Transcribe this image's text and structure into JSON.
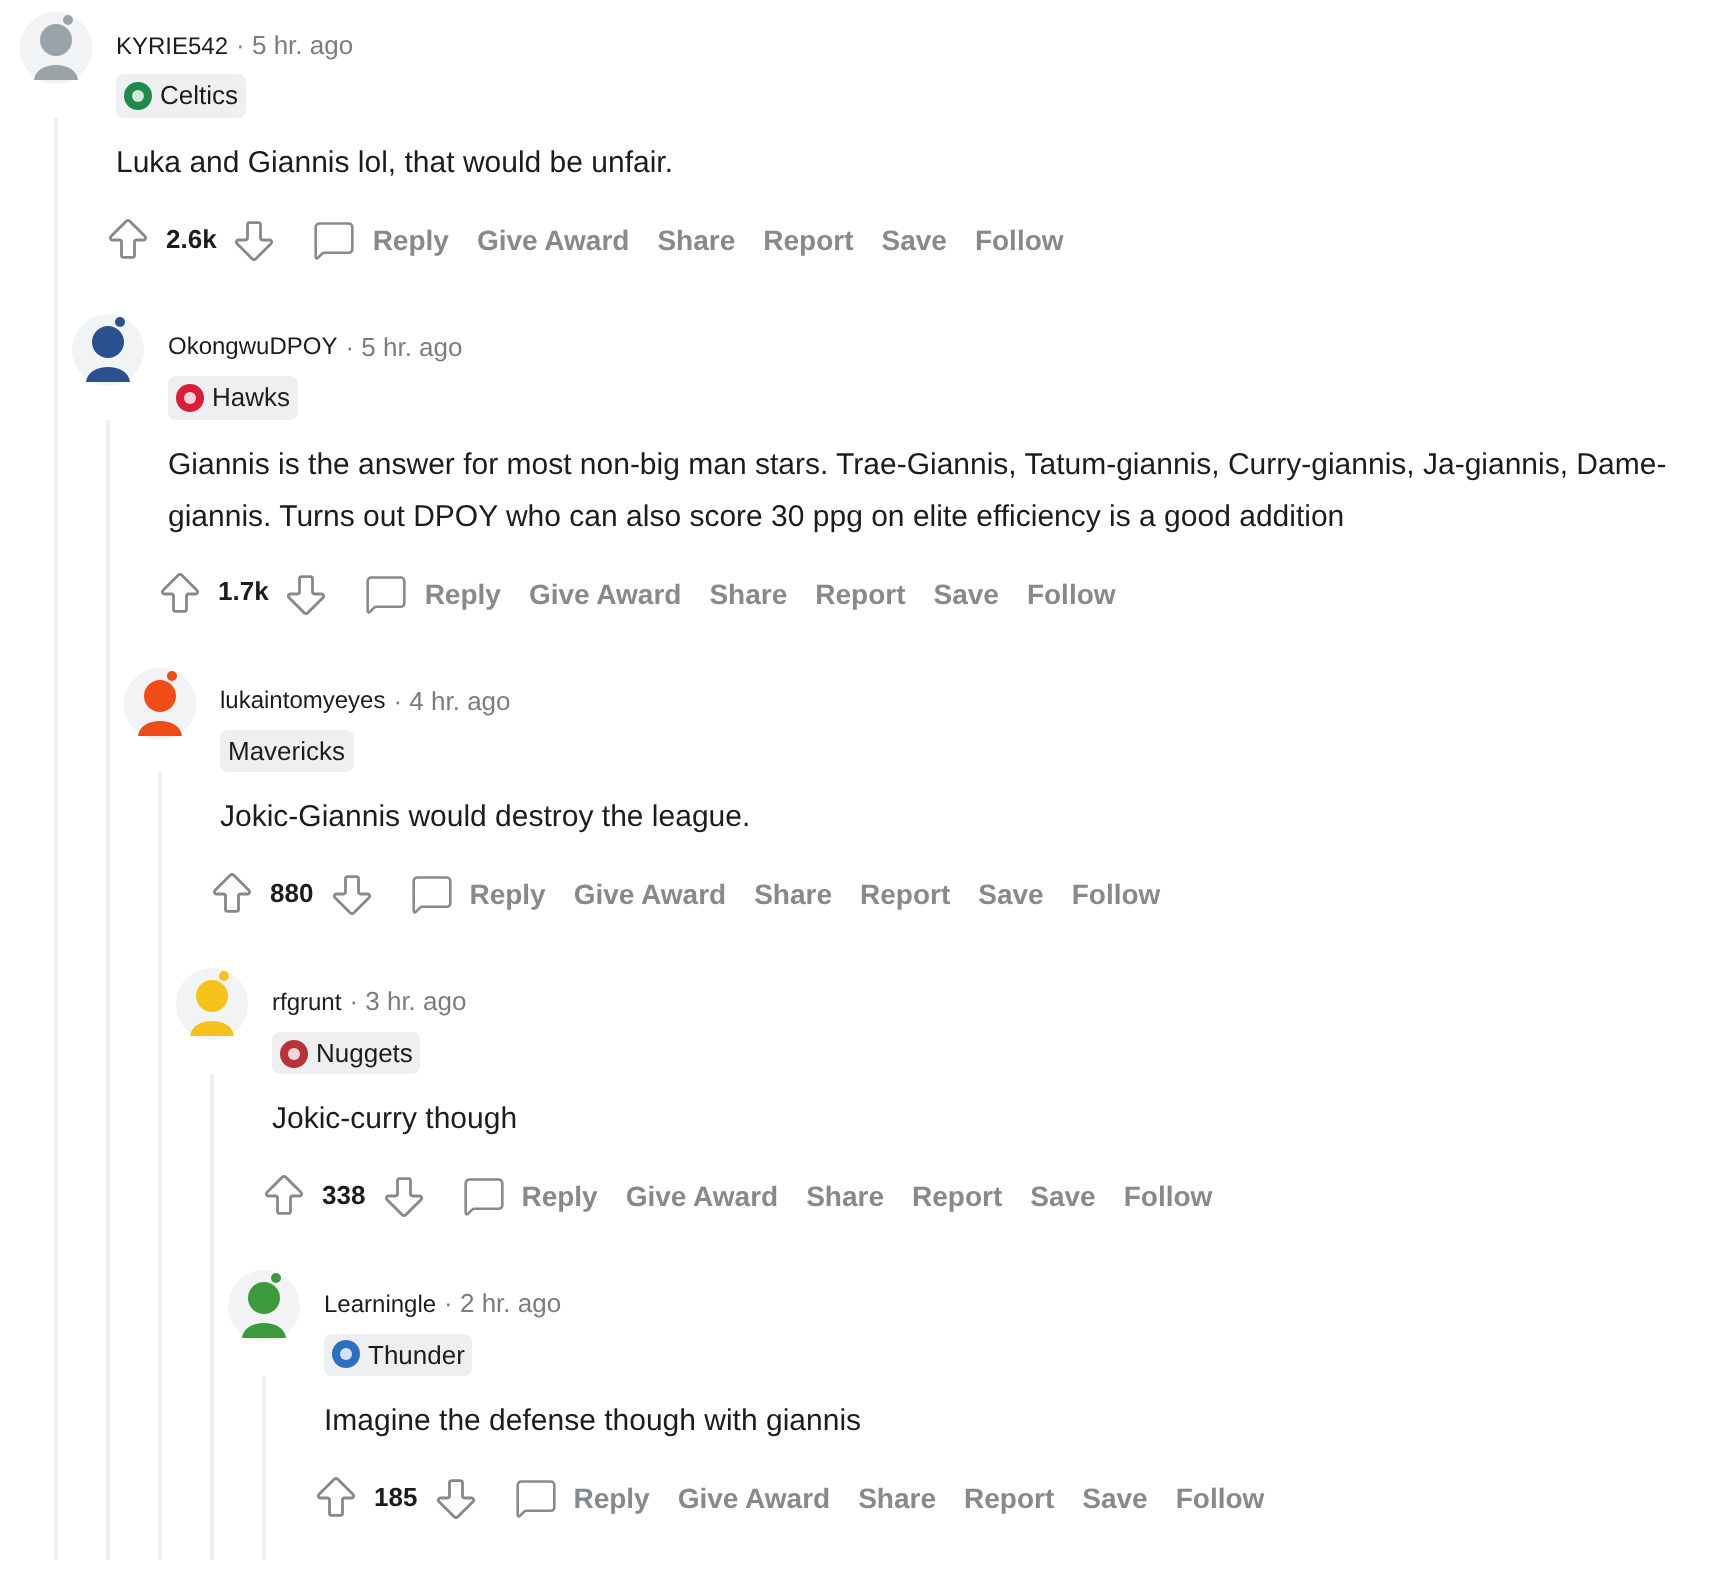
{
  "comments": [
    {
      "username": "KYRIE542",
      "time": "· 5 hr. ago",
      "avatar": {
        "color": "#9aa3a8"
      },
      "flair": {
        "label": "Celtics",
        "color": "#1f8a4c"
      },
      "body": "Luka and Giannis lol, that would be unfair.",
      "votes": "2.6k",
      "actions": [
        "Reply",
        "Give Award",
        "Share",
        "Report",
        "Save",
        "Follow"
      ],
      "children": [
        {
          "username": "OkongwuDPOY",
          "time": "· 5 hr. ago",
          "avatar": {
            "color": "#2b4f8f"
          },
          "flair": {
            "label": "Hawks",
            "color": "#d71f3a"
          },
          "body": "Giannis is the answer for most non-big man stars. Trae-Giannis, Tatum-giannis, Curry-giannis, Ja-giannis, Dame-giannis. Turns out DPOY who can also score 30 ppg on elite efficiency is a good addition",
          "votes": "1.7k",
          "actions": [
            "Reply",
            "Give Award",
            "Share",
            "Report",
            "Save",
            "Follow"
          ],
          "children": [
            {
              "username": "lukaintomyeyes",
              "time": "· 4 hr. ago",
              "avatar": {
                "color": "#ee4b16"
              },
              "flair": {
                "label": "Mavericks"
              },
              "body": "Jokic-Giannis would destroy the league.",
              "votes": "880",
              "actions": [
                "Reply",
                "Give Award",
                "Share",
                "Report",
                "Save",
                "Follow"
              ],
              "children": [
                {
                  "username": "rfgrunt",
                  "time": "· 3 hr. ago",
                  "avatar": {
                    "color": "#f4c21b"
                  },
                  "flair": {
                    "label": "Nuggets",
                    "color": "#b8323a"
                  },
                  "body": "Jokic-curry though",
                  "votes": "338",
                  "actions": [
                    "Reply",
                    "Give Award",
                    "Share",
                    "Report",
                    "Save",
                    "Follow"
                  ],
                  "children": [
                    {
                      "username": "Learningle",
                      "time": "· 2 hr. ago",
                      "avatar": {
                        "color": "#3c9a3c"
                      },
                      "flair": {
                        "label": "Thunder",
                        "color": "#2f6fc0"
                      },
                      "body": "Imagine the defense though with giannis",
                      "votes": "185",
                      "actions": [
                        "Reply",
                        "Give Award",
                        "Share",
                        "Report",
                        "Save",
                        "Follow"
                      ]
                    }
                  ]
                }
              ]
            }
          ]
        }
      ]
    }
  ]
}
